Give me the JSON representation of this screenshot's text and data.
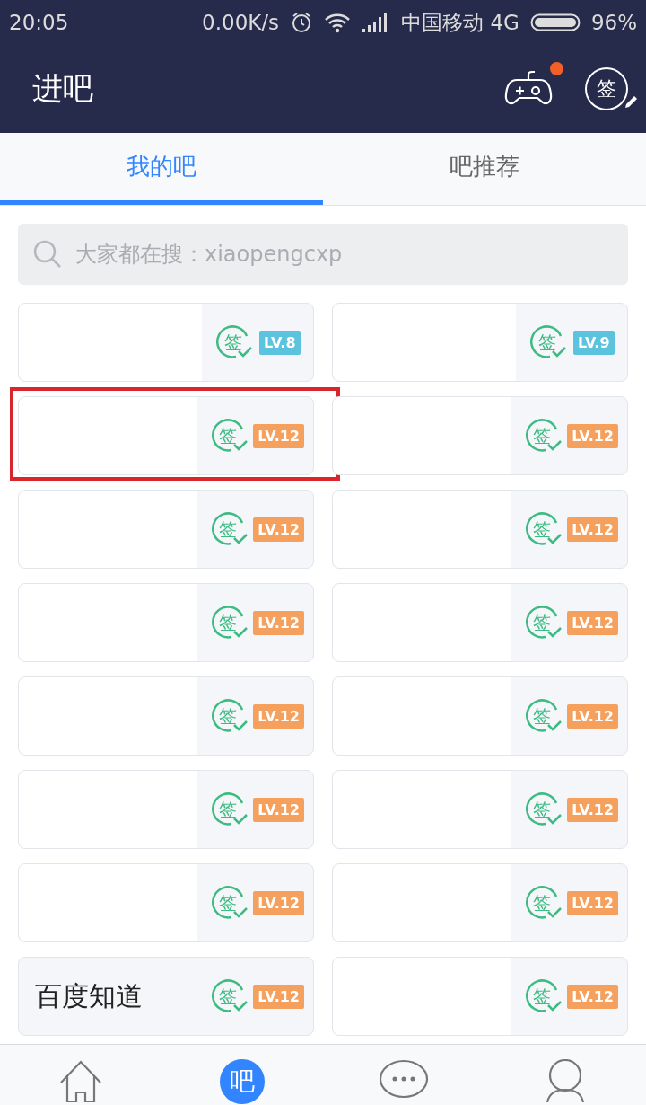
{
  "status_bar": {
    "time": "20:05",
    "speed": "0.00K/s",
    "carrier": "中国移动 4G",
    "battery": "96%"
  },
  "header": {
    "title": "进吧",
    "game_badge": true,
    "sign_text": "签"
  },
  "tabs": [
    {
      "label": "我的吧",
      "selected": true
    },
    {
      "label": "吧推荐",
      "selected": false
    }
  ],
  "search": {
    "placeholder": "大家都在搜：xiaopengcxp"
  },
  "forums": [
    {
      "sign_text": "签",
      "level": "LV.8",
      "color": "#5bc3dd",
      "highlighted": false
    },
    {
      "sign_text": "签",
      "level": "LV.9",
      "color": "#5bc3dd",
      "highlighted": false
    },
    {
      "sign_text": "签",
      "level": "LV.12",
      "color": "#f5a15d",
      "highlighted": true
    },
    {
      "sign_text": "签",
      "level": "LV.12",
      "color": "#f5a15d",
      "highlighted": false
    },
    {
      "sign_text": "签",
      "level": "LV.12",
      "color": "#f5a15d",
      "highlighted": false
    },
    {
      "sign_text": "签",
      "level": "LV.12",
      "color": "#f5a15d",
      "highlighted": false
    },
    {
      "sign_text": "签",
      "level": "LV.12",
      "color": "#f5a15d",
      "highlighted": false
    },
    {
      "sign_text": "签",
      "level": "LV.12",
      "color": "#f5a15d",
      "highlighted": false
    },
    {
      "sign_text": "签",
      "level": "LV.12",
      "color": "#f5a15d",
      "highlighted": false
    },
    {
      "sign_text": "签",
      "level": "LV.12",
      "color": "#f5a15d",
      "highlighted": false
    },
    {
      "sign_text": "签",
      "level": "LV.12",
      "color": "#f5a15d",
      "highlighted": false
    },
    {
      "sign_text": "签",
      "level": "LV.12",
      "color": "#f5a15d",
      "highlighted": false
    },
    {
      "sign_text": "签",
      "level": "LV.12",
      "color": "#f5a15d",
      "highlighted": false
    },
    {
      "sign_text": "签",
      "level": "LV.12",
      "color": "#f5a15d",
      "highlighted": false
    },
    {
      "name": "百度知道",
      "sign_text": "签",
      "level": "LV.12",
      "color": "#f5a15d",
      "highlighted": false
    },
    {
      "sign_text": "签",
      "level": "LV.12",
      "color": "#f5a15d",
      "highlighted": false
    }
  ],
  "bottom_nav": [
    {
      "kind": "home",
      "selected": false
    },
    {
      "kind": "forum",
      "label": "吧",
      "selected": true
    },
    {
      "kind": "messages",
      "selected": false
    },
    {
      "kind": "profile",
      "selected": false
    }
  ]
}
